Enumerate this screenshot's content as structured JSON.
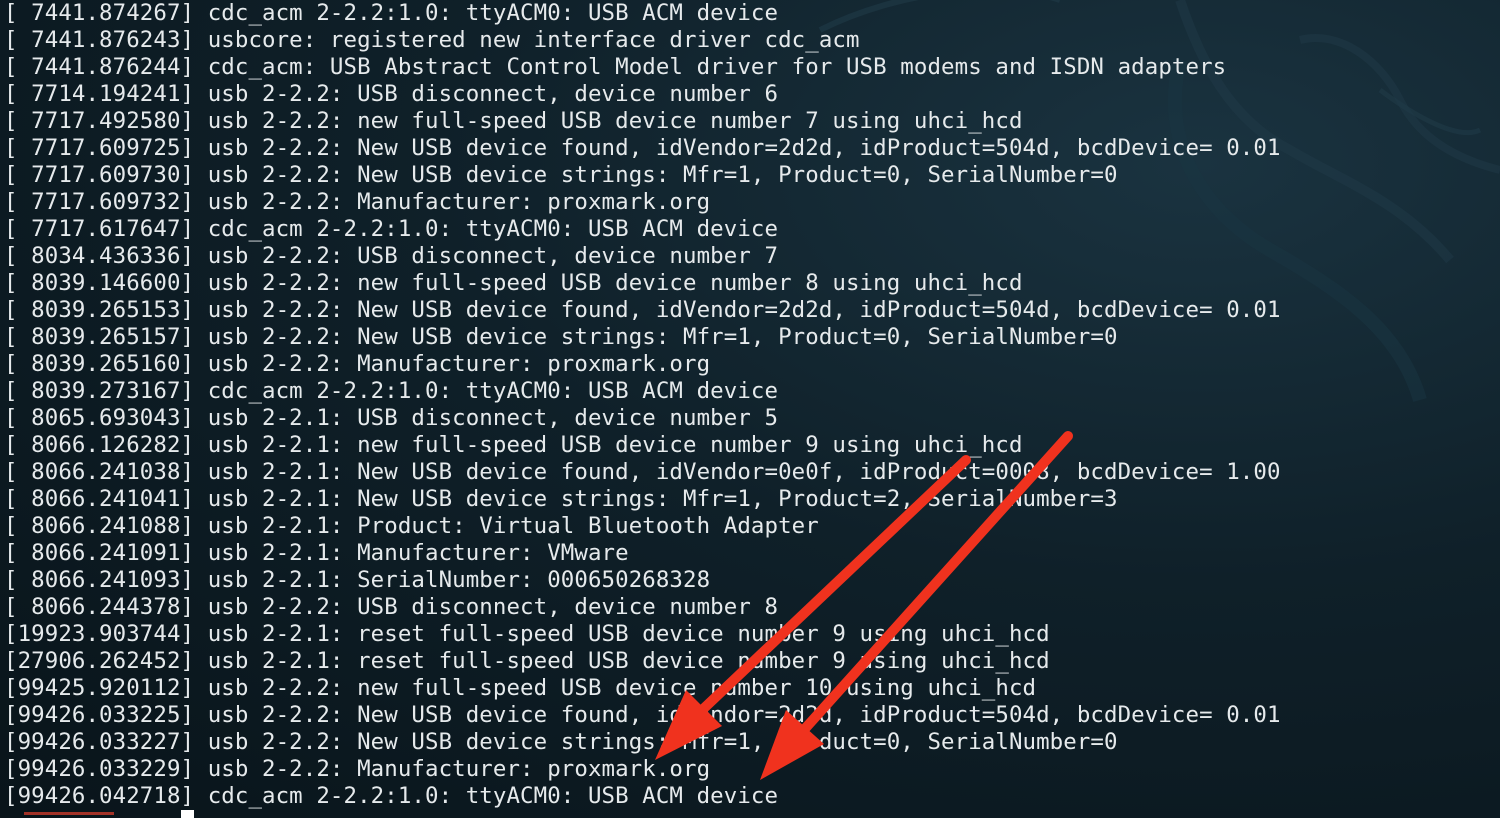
{
  "terminal": {
    "lines": [
      "[ 7441.874267] cdc_acm 2-2.2:1.0: ttyACM0: USB ACM device",
      "[ 7441.876243] usbcore: registered new interface driver cdc_acm",
      "[ 7441.876244] cdc_acm: USB Abstract Control Model driver for USB modems and ISDN adapters",
      "[ 7714.194241] usb 2-2.2: USB disconnect, device number 6",
      "[ 7717.492580] usb 2-2.2: new full-speed USB device number 7 using uhci_hcd",
      "[ 7717.609725] usb 2-2.2: New USB device found, idVendor=2d2d, idProduct=504d, bcdDevice= 0.01",
      "[ 7717.609730] usb 2-2.2: New USB device strings: Mfr=1, Product=0, SerialNumber=0",
      "[ 7717.609732] usb 2-2.2: Manufacturer: proxmark.org",
      "[ 7717.617647] cdc_acm 2-2.2:1.0: ttyACM0: USB ACM device",
      "[ 8034.436336] usb 2-2.2: USB disconnect, device number 7",
      "[ 8039.146600] usb 2-2.2: new full-speed USB device number 8 using uhci_hcd",
      "[ 8039.265153] usb 2-2.2: New USB device found, idVendor=2d2d, idProduct=504d, bcdDevice= 0.01",
      "[ 8039.265157] usb 2-2.2: New USB device strings: Mfr=1, Product=0, SerialNumber=0",
      "[ 8039.265160] usb 2-2.2: Manufacturer: proxmark.org",
      "[ 8039.273167] cdc_acm 2-2.2:1.0: ttyACM0: USB ACM device",
      "[ 8065.693043] usb 2-2.1: USB disconnect, device number 5",
      "[ 8066.126282] usb 2-2.1: new full-speed USB device number 9 using uhci_hcd",
      "[ 8066.241038] usb 2-2.1: New USB device found, idVendor=0e0f, idProduct=0008, bcdDevice= 1.00",
      "[ 8066.241041] usb 2-2.1: New USB device strings: Mfr=1, Product=2, SerialNumber=3",
      "[ 8066.241088] usb 2-2.1: Product: Virtual Bluetooth Adapter",
      "[ 8066.241091] usb 2-2.1: Manufacturer: VMware",
      "[ 8066.241093] usb 2-2.1: SerialNumber: 000650268328",
      "[ 8066.244378] usb 2-2.2: USB disconnect, device number 8",
      "[19923.903744] usb 2-2.1: reset full-speed USB device number 9 using uhci_hcd",
      "[27906.262452] usb 2-2.1: reset full-speed USB device number 9 using uhci_hcd",
      "[99425.920112] usb 2-2.2: new full-speed USB device number 10 using uhci_hcd",
      "[99426.033225] usb 2-2.2: New USB device found, idVendor=2d2d, idProduct=504d, bcdDevice= 0.01",
      "[99426.033227] usb 2-2.2: New USB device strings: Mfr=1, Product=0, SerialNumber=0",
      "[99426.033229] usb 2-2.2: Manufacturer: proxmark.org",
      "[99426.042718] cdc_acm 2-2.2:1.0: ttyACM0: USB ACM device"
    ]
  },
  "colors": {
    "text": "#e6eaec",
    "background": "#0b1820",
    "annotation_arrow": "#f0321e",
    "cursor": "#ffffff"
  },
  "annotations": {
    "arrow_icon": "red-arrow-icon"
  }
}
